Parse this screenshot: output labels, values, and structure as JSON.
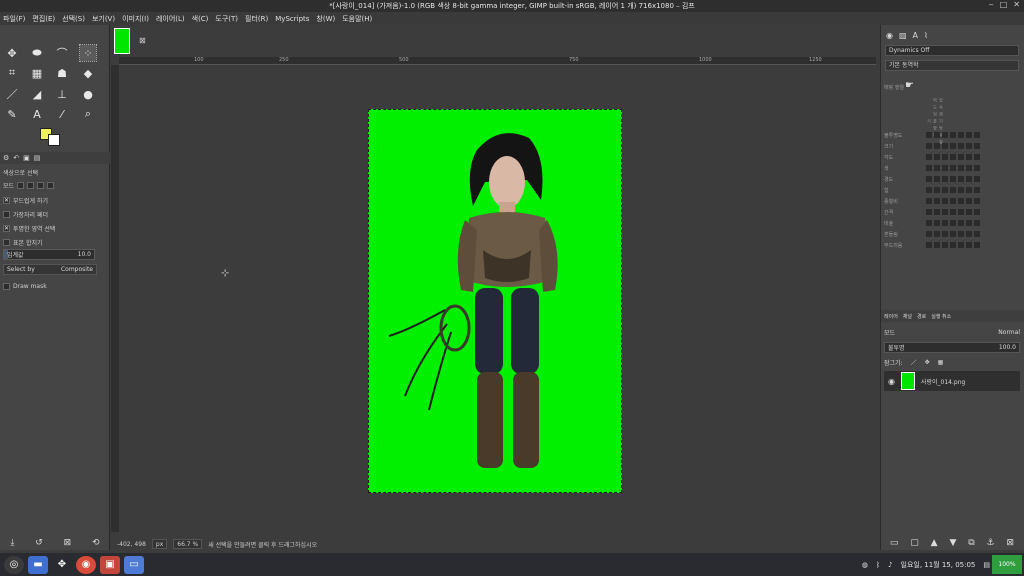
{
  "window": {
    "title": "*[사랑이_014] (가져옴)-1.0 (RGB 색상 8-bit gamma integer, GIMP built-in sRGB, 레이어 1 개) 716x1080 – 김프"
  },
  "menu": [
    "파일(F)",
    "편집(E)",
    "선택(S)",
    "보기(V)",
    "이미지(I)",
    "레이어(L)",
    "색(C)",
    "도구(T)",
    "필터(R)",
    "MyScripts",
    "창(W)",
    "도움말(H)"
  ],
  "tool_options": {
    "title": "색상으로 선택",
    "mode_label": "모드",
    "antialias": "부드럽게 하기",
    "feather": "가장자리 페더",
    "select_transparent": "투명한 영역 선택",
    "sample_merged": "표본 합치기",
    "threshold_label": "임계값",
    "threshold_value": "10.0",
    "threshold_fraction": 0.04,
    "select_by_label": "Select by",
    "select_by_value": "Composite",
    "draw_mask": "Draw mask"
  },
  "colors": {
    "foreground": "#f0f060",
    "background": "#ffffff",
    "image_bg": "#00f000"
  },
  "canvas": {
    "ruler_marks": [
      "100",
      "250",
      "500",
      "750",
      "1000",
      "1250"
    ]
  },
  "statusbar": {
    "coords": "-402, 498",
    "unit": "px",
    "zoom": "66.7 %",
    "message": "새 선택을 만들려면 클릭 후 드래그하십시오"
  },
  "dynamics": {
    "name": "Dynamics Off",
    "preset": "기본 동역학",
    "mapping_label": "매핑 행렬",
    "columns": [
      "압력",
      "속도",
      "랜덤",
      "기울기",
      "방향",
      "페이드",
      "휠"
    ],
    "rows": [
      "불투명도",
      "크기",
      "각도",
      "색",
      "경도",
      "힘",
      "종횡비",
      "간격",
      "비율",
      "흔들림",
      "부드러움"
    ]
  },
  "layers": {
    "tabs": [
      "레이어",
      "채널",
      "경로",
      "실행 취소"
    ],
    "mode_label": "모드",
    "mode_value": "Normal",
    "opacity_label": "불투명",
    "opacity_value": "100.0",
    "lock_label": "잠그기:",
    "layer_name": "사랑이_014.png"
  },
  "taskbar": {
    "time": "일요일, 11월 15, 05:05",
    "battery": "100%"
  }
}
